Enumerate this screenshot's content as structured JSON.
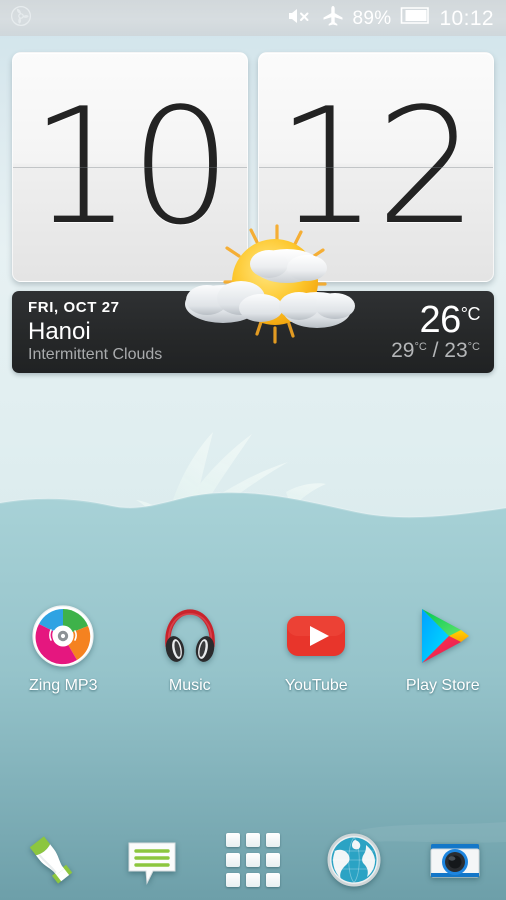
{
  "statusbar": {
    "left_icons": [
      {
        "name": "pinwheel-notification-icon",
        "glyph": "pinwheel"
      }
    ],
    "right_icons": [
      {
        "name": "mute-icon",
        "glyph": "speaker-muted"
      },
      {
        "name": "airplane-mode-icon",
        "glyph": "airplane"
      }
    ],
    "battery_percent": "89%",
    "battery_icon": "battery-icon",
    "time": "10:12"
  },
  "clock": {
    "hours": "10",
    "minutes": "12"
  },
  "weather": {
    "date": "FRI, OCT 27",
    "city": "Hanoi",
    "condition": "Intermittent Clouds",
    "temp": "26",
    "temp_unit": "°C",
    "high": "29",
    "high_unit": "°C",
    "separator": " / ",
    "low": "23",
    "low_unit": "°C",
    "icon": "sun-behind-clouds-icon"
  },
  "apps": [
    {
      "label": "Zing MP3",
      "icon": "zing-mp3-icon"
    },
    {
      "label": "Music",
      "icon": "headphones-icon"
    },
    {
      "label": "YouTube",
      "icon": "youtube-icon"
    },
    {
      "label": "Play Store",
      "icon": "play-store-icon"
    }
  ],
  "dock": [
    {
      "name": "phone",
      "icon": "phone-icon"
    },
    {
      "name": "messages",
      "icon": "message-bubble-icon"
    },
    {
      "name": "app-drawer",
      "icon": "grid-icon"
    },
    {
      "name": "browser",
      "icon": "globe-icon"
    },
    {
      "name": "camera",
      "icon": "camera-icon"
    }
  ],
  "colors": {
    "sky_top": "#cfe3ea",
    "sea": "#9fcdd3",
    "sea_deep": "#74a7b0",
    "widget_bg": "#2a2c2e",
    "accent_green": "#8cc63f",
    "youtube_red": "#e8352b"
  }
}
